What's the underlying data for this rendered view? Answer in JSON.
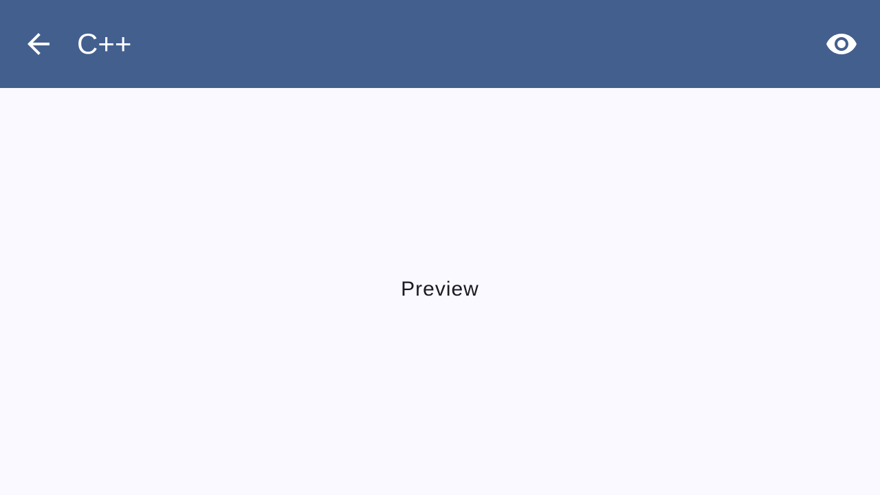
{
  "app_bar": {
    "title": "C++",
    "back_icon": "arrow-back-icon",
    "preview_icon": "eye-icon",
    "background": "#435f8e"
  },
  "main": {
    "text": "Preview",
    "background": "#f9f9ff"
  }
}
